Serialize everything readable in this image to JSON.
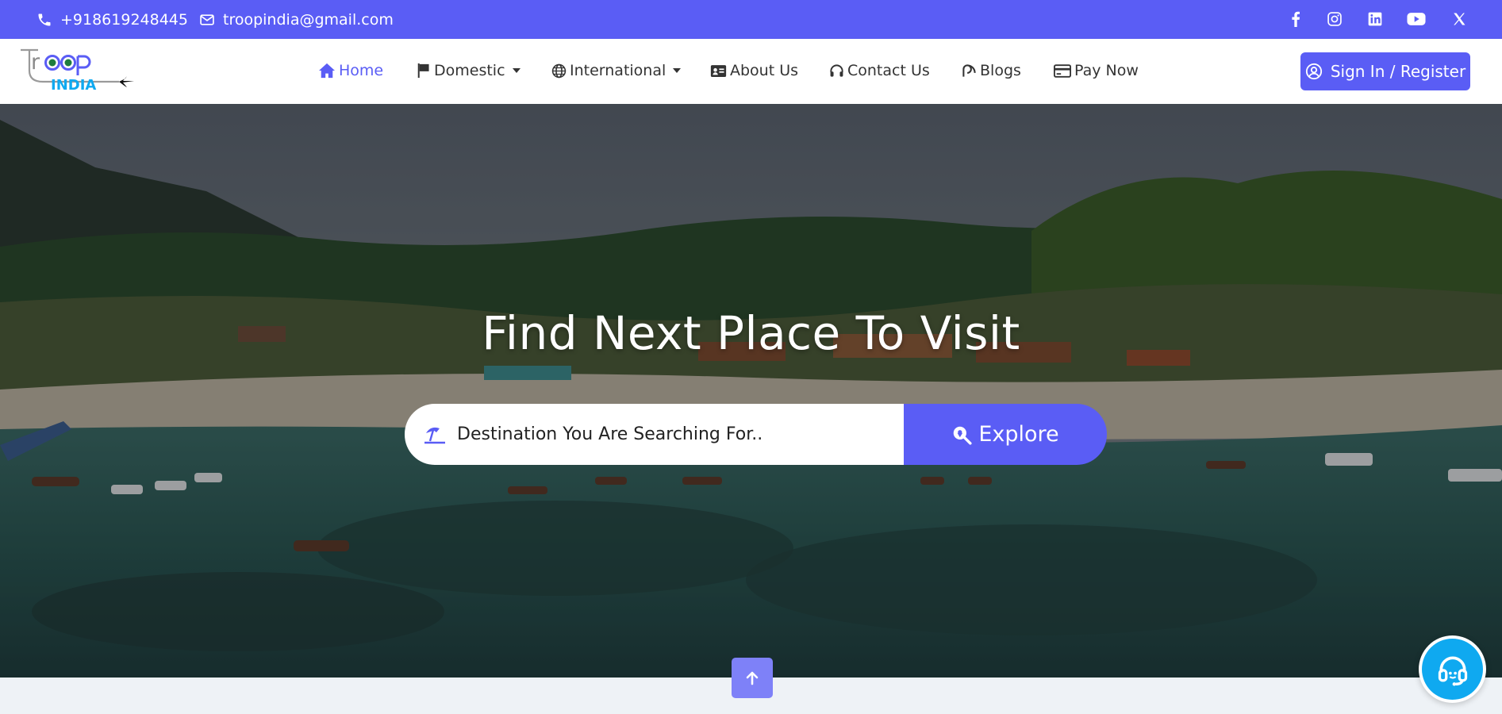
{
  "topbar": {
    "phone": "+918619248445",
    "email": "troopindia@gmail.com",
    "social": [
      "facebook-icon",
      "instagram-icon",
      "linkedin-icon",
      "youtube-icon",
      "x-icon"
    ]
  },
  "logo": {
    "line1": "Troop",
    "line2": "INDIA"
  },
  "nav": {
    "home": "Home",
    "domestic": "Domestic",
    "international": "International",
    "about": "About Us",
    "contact": "Contact Us",
    "blogs": "Blogs",
    "pay": "Pay Now"
  },
  "signin": {
    "label": "Sign In / Register"
  },
  "hero": {
    "title": "Find Next Place To Visit",
    "search_placeholder": "Destination You Are Searching For..",
    "explore_label": "Explore"
  },
  "colors": {
    "accent": "#5a5df5",
    "support": "#0fa9f0"
  }
}
